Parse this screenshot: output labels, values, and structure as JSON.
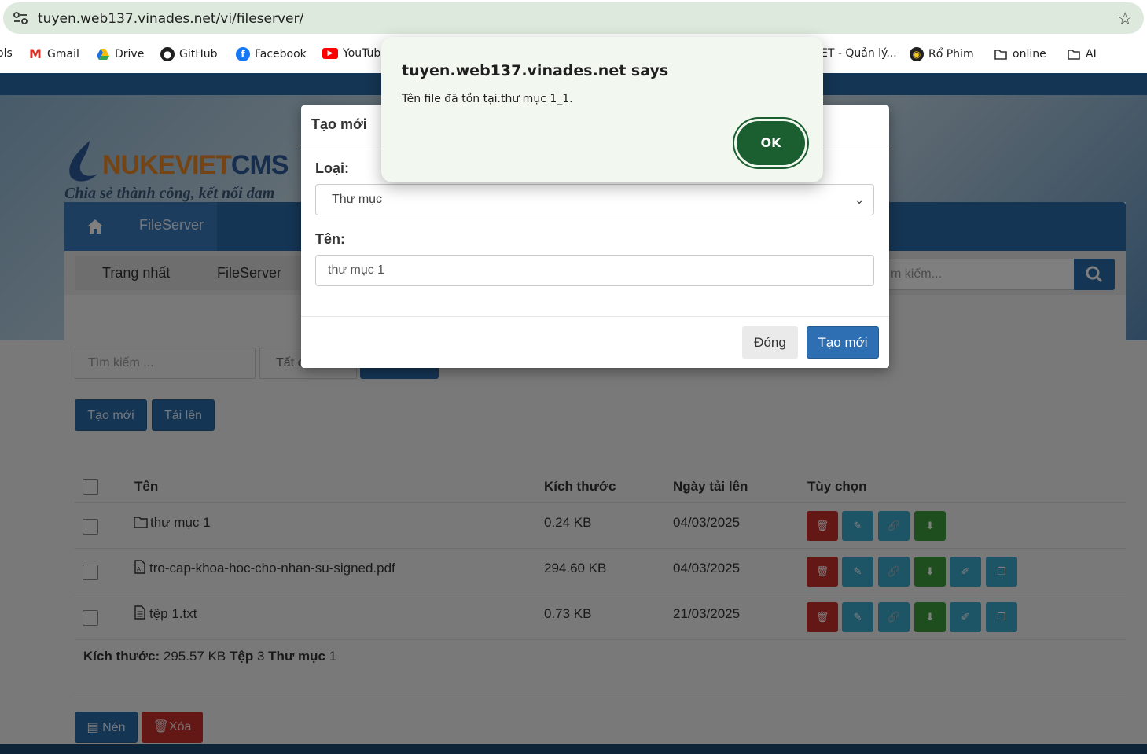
{
  "browser": {
    "url": "tuyen.web137.vinades.net/vi/fileserver/",
    "bookmarks": [
      {
        "label": "ols",
        "icon": "apps-icon"
      },
      {
        "label": "Gmail",
        "icon": "gmail-icon"
      },
      {
        "label": "Drive",
        "icon": "drive-icon"
      },
      {
        "label": "GitHub",
        "icon": "github-icon"
      },
      {
        "label": "Facebook",
        "icon": "facebook-icon"
      },
      {
        "label": "YouTub",
        "icon": "youtube-icon"
      },
      {
        "label": "ET - Quản lý...",
        "icon": "page-icon"
      },
      {
        "label": "Rổ Phim",
        "icon": "film-icon"
      },
      {
        "label": "online",
        "icon": "folder-icon"
      },
      {
        "label": "AI",
        "icon": "folder-icon"
      }
    ]
  },
  "site": {
    "logo_part1": "NUKEVIET",
    "logo_part2": "CMS",
    "slogan": "Chia sẻ thành công, kết nối đam",
    "nav": {
      "home_icon": "home-icon",
      "fileserver": "FileServer"
    },
    "breadcrumbs": [
      "Trang nhất",
      "FileServer"
    ],
    "search_placeholder": "m kiếm..."
  },
  "filters": {
    "search_placeholder": "Tìm kiếm ...",
    "type_value": "Tất c"
  },
  "actions": {
    "create": "Tạo mới",
    "upload": "Tải lên",
    "compress": "Nén",
    "delete": "Xóa"
  },
  "table": {
    "headers": {
      "name": "Tên",
      "size": "Kích thước",
      "date": "Ngày tải lên",
      "options": "Tùy chọn"
    },
    "rows": [
      {
        "name": "thư mục 1",
        "type": "folder",
        "size": "0.24 KB",
        "date": "04/03/2025"
      },
      {
        "name": "tro-cap-khoa-hoc-cho-nhan-su-signed.pdf",
        "type": "pdf",
        "size": "294.60 KB",
        "date": "04/03/2025"
      },
      {
        "name": "tệp 1.txt",
        "type": "txt",
        "size": "0.73 KB",
        "date": "21/03/2025"
      }
    ]
  },
  "summary": {
    "size_label": "Kích thước:",
    "size_value": "295.57 KB",
    "files_label": "Tệp",
    "files_value": "3",
    "folders_label": "Thư mục",
    "folders_value": "1"
  },
  "modal": {
    "title": "Tạo mới",
    "type_label": "Loại:",
    "type_value": "Thư mục",
    "name_label": "Tên:",
    "name_value": "thư mục 1",
    "close_button": "Đóng",
    "create_button": "Tạo mới"
  },
  "alert": {
    "title": "tuyen.web137.vinades.net says",
    "message": "Tên file đã tồn tại.thư mục 1_1.",
    "ok_button": "OK"
  },
  "colors": {
    "primary": "#2b6ba8",
    "danger": "#c9302c",
    "info": "#3aa8cc",
    "success": "#3c9a3c",
    "alert_ok": "#1b5e2f"
  }
}
